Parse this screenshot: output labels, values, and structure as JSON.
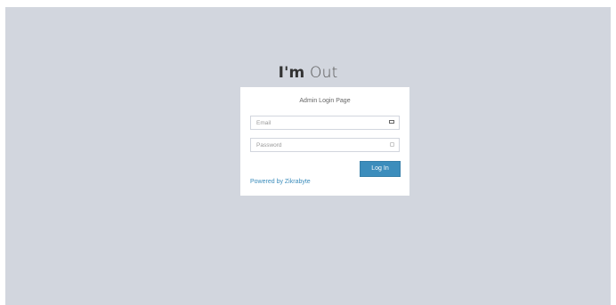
{
  "logo": {
    "bold": "I'm",
    "light": "Out"
  },
  "login_box": {
    "message": "Admin Login Page",
    "email_placeholder": "Email",
    "password_placeholder": "Password",
    "submit_label": "Log In",
    "powered_by": "Powered by Zikrabyte"
  },
  "icons": {
    "email": "envelope-icon",
    "password": "lock-icon"
  },
  "colors": {
    "background": "#d2d6de",
    "primary": "#3c8dbc",
    "box": "#ffffff"
  }
}
